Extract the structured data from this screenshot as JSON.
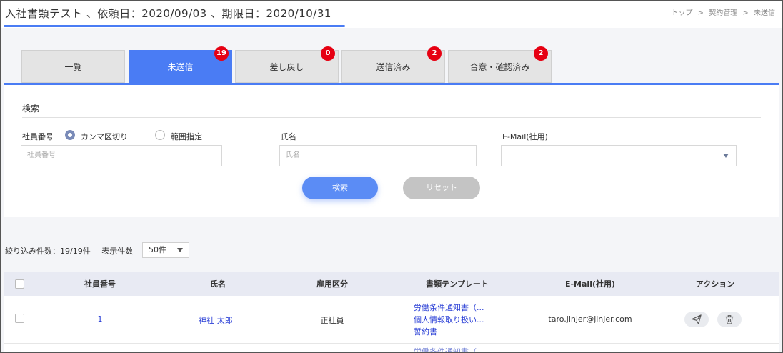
{
  "page": {
    "title": "入社書類テスト 、依頼日：2020/09/03 、期限日：2020/10/31",
    "breadcrumb": [
      "トップ",
      ">",
      "契約管理",
      ">",
      "未送信"
    ]
  },
  "tabs": [
    {
      "label": "一覧",
      "badge": ""
    },
    {
      "label": "未送信",
      "badge": "19"
    },
    {
      "label": "差し戻し",
      "badge": "0"
    },
    {
      "label": "送信済み",
      "badge": "2"
    },
    {
      "label": "合意・確認済み",
      "badge": "2"
    }
  ],
  "search": {
    "heading": "検索",
    "employee_no_label": "社員番号",
    "radio_comma": "カンマ区切り",
    "radio_range": "範囲指定",
    "employee_no_placeholder": "社員番号",
    "name_label": "氏名",
    "name_placeholder": "氏名",
    "email_label": "E-Mail(社用)",
    "search_button": "検索",
    "reset_button": "リセット"
  },
  "filter": {
    "count_text": "絞り込み件数：19/19件",
    "page_size_label": "表示件数",
    "page_size_value": "50件"
  },
  "table": {
    "columns": [
      "社員番号",
      "氏名",
      "雇用区分",
      "書類テンプレート",
      "E-Mail(社用)",
      "アクション"
    ],
    "rows": [
      {
        "employee_no": "1",
        "name": "神社 太郎",
        "employment_type": "正社員",
        "templates": [
          "労働条件通知書（...",
          "個人情報取り扱い...",
          "誓約書"
        ],
        "email": "taro.jinjer@jinjer.com"
      }
    ],
    "next_row_peek": "労働条件通知書（..."
  },
  "icons": {
    "send": "paper-plane-icon",
    "delete": "trash-icon",
    "dropdown": "chevron-down-icon"
  },
  "colors": {
    "accent": "#4a7cf4",
    "badge": "#e60012",
    "link": "#2a3fd6"
  }
}
